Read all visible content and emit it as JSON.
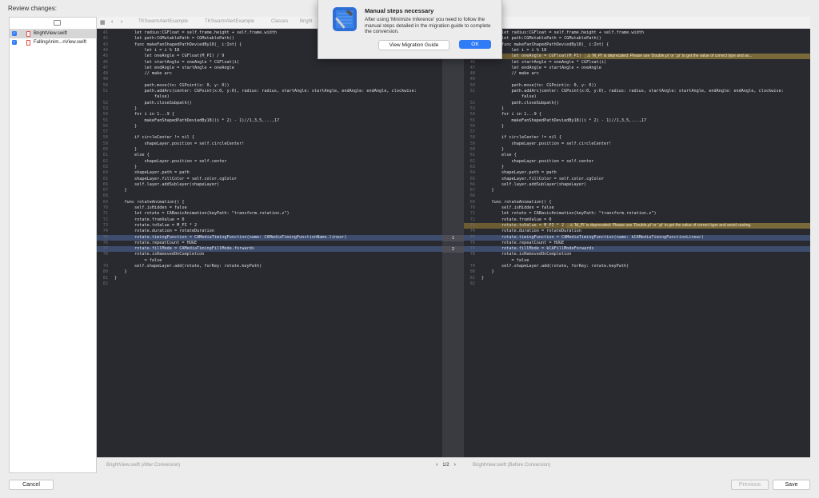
{
  "window": {
    "title": "Review changes:"
  },
  "sidebar": {
    "files": [
      {
        "name": "BrightView.swift",
        "checked": true,
        "selected": true
      },
      {
        "name": "FallingAnim...nView.swift",
        "checked": true,
        "selected": false
      }
    ]
  },
  "toolbar": {
    "crumbs": [
      "TKSwarmAlertExample",
      "TKSwarmAlertExample",
      "Classes",
      "Bright"
    ]
  },
  "left_code": [
    {
      "n": "41",
      "t": "        let radius:CGFloat = self.frame.height + self.frame.width"
    },
    {
      "n": "42",
      "t": "        let path:CGMutablePath = CGMutablePath()"
    },
    {
      "n": "43",
      "t": "        func makeFanShapedPathDeviedBy18(_ i:Int) {"
    },
    {
      "n": "44",
      "t": "            let i = i % 18"
    },
    {
      "n": "45",
      "t": "            let oneAngle = CGFloat(M_PI) / 9"
    },
    {
      "n": "46",
      "t": "            let startAngle = oneAngle * CGFloat(i)"
    },
    {
      "n": "47",
      "t": "            let endAngle = startAngle + oneAngle"
    },
    {
      "n": "48",
      "t": "            // make arc"
    },
    {
      "n": "49",
      "t": ""
    },
    {
      "n": "50",
      "t": "            path.move(to: CGPoint(x: 0, y: 0))"
    },
    {
      "n": "51",
      "t": "            path.addArc(center: CGPoint(x:0, y:0), radius: radius, startAngle: startAngle, endAngle: endAngle, clockwise:"
    },
    {
      "n": "",
      "t": "                false)"
    },
    {
      "n": "52",
      "t": "            path.closeSubpath()"
    },
    {
      "n": "53",
      "t": "        }"
    },
    {
      "n": "54",
      "t": "        for i in 1...9 {"
    },
    {
      "n": "55",
      "t": "            makeFanShapedPathDeviedBy18((i * 2) - 1)//1,3,5,...,17"
    },
    {
      "n": "56",
      "t": "        }"
    },
    {
      "n": "57",
      "t": ""
    },
    {
      "n": "58",
      "t": "        if circleCenter != nil {"
    },
    {
      "n": "59",
      "t": "            shapeLayer.position = self.circleCenter!"
    },
    {
      "n": "60",
      "t": "        }"
    },
    {
      "n": "61",
      "t": "        else {"
    },
    {
      "n": "62",
      "t": "            shapeLayer.position = self.center"
    },
    {
      "n": "63",
      "t": "        }"
    },
    {
      "n": "64",
      "t": "        shapeLayer.path = path"
    },
    {
      "n": "65",
      "t": "        shapeLayer.fillColor = self.color.cgColor"
    },
    {
      "n": "66",
      "t": "        self.layer.addSublayer(shapeLayer)"
    },
    {
      "n": "67",
      "t": "    }"
    },
    {
      "n": "68",
      "t": ""
    },
    {
      "n": "69",
      "t": "    func rotateAnimation() {"
    },
    {
      "n": "70",
      "t": "        self.isHidden = false"
    },
    {
      "n": "71",
      "t": "        let rotate = CABasicAnimation(keyPath: \"transform.rotation.z\")"
    },
    {
      "n": "72",
      "t": "        rotate.fromValue = 0"
    },
    {
      "n": "73",
      "t": "        rotate.toValue = M_PI * 2"
    },
    {
      "n": "74",
      "t": "        rotate.duration = rotateDuration"
    },
    {
      "n": "75",
      "t": "        rotate.timingFunction = CAMediaTimingFunction(name: CAMediaTimingFunctionName.linear)",
      "hl": true
    },
    {
      "n": "76",
      "t": "        rotate.repeatCount = HUGE"
    },
    {
      "n": "77",
      "t": "        rotate.fillMode = CAMediaTimingFillMode.forwards",
      "hl": true
    },
    {
      "n": "78",
      "t": "        rotate.isRemovedOnCompletion"
    },
    {
      "n": "",
      "t": "            = false"
    },
    {
      "n": "79",
      "t": "        self.shapeLayer.add(rotate, forKey: rotate.keyPath)"
    },
    {
      "n": "80",
      "t": "    }"
    },
    {
      "n": "81",
      "t": "}"
    },
    {
      "n": "82",
      "t": ""
    }
  ],
  "right_code": [
    {
      "n": "41",
      "t": "        let radius:CGFloat = self.frame.height + self.frame.width"
    },
    {
      "n": "42",
      "t": "        let path:CGMutablePath = CGMutablePath()"
    },
    {
      "n": "43",
      "t": "        func makeFanShapedPathDeviedBy18(_ i:Int) {"
    },
    {
      "n": "44",
      "t": "            let i = i % 18"
    },
    {
      "n": "45",
      "t": "            let oneAngle = CGFloat(M_PI) / 9",
      "warn": true
    },
    {
      "n": "46",
      "t": "            let startAngle = oneAngle * CGFloat(i)"
    },
    {
      "n": "47",
      "t": "            let endAngle = startAngle + oneAngle"
    },
    {
      "n": "48",
      "t": "            // make arc"
    },
    {
      "n": "49",
      "t": ""
    },
    {
      "n": "50",
      "t": "            path.move(to: CGPoint(x: 0, y: 0))"
    },
    {
      "n": "51",
      "t": "            path.addArc(center: CGPoint(x:0, y:0), radius: radius, startAngle: startAngle, endAngle: endAngle, clockwise:"
    },
    {
      "n": "",
      "t": "                false)"
    },
    {
      "n": "52",
      "t": "            path.closeSubpath()"
    },
    {
      "n": "53",
      "t": "        }"
    },
    {
      "n": "54",
      "t": "        for i in 1...9 {"
    },
    {
      "n": "55",
      "t": "            makeFanShapedPathDeviedBy18((i * 2) - 1)//1,3,5,...,17"
    },
    {
      "n": "56",
      "t": "        }"
    },
    {
      "n": "57",
      "t": ""
    },
    {
      "n": "58",
      "t": "        if circleCenter != nil {"
    },
    {
      "n": "59",
      "t": "            shapeLayer.position = self.circleCenter!"
    },
    {
      "n": "60",
      "t": "        }"
    },
    {
      "n": "61",
      "t": "        else {"
    },
    {
      "n": "62",
      "t": "            shapeLayer.position = self.center"
    },
    {
      "n": "63",
      "t": "        }"
    },
    {
      "n": "64",
      "t": "        shapeLayer.path = path"
    },
    {
      "n": "65",
      "t": "        shapeLayer.fillColor = self.color.cgColor"
    },
    {
      "n": "66",
      "t": "        self.layer.addSublayer(shapeLayer)"
    },
    {
      "n": "67",
      "t": "    }"
    },
    {
      "n": "68",
      "t": ""
    },
    {
      "n": "69",
      "t": "    func rotateAnimation() {"
    },
    {
      "n": "70",
      "t": "        self.isHidden = false"
    },
    {
      "n": "71",
      "t": "        let rotate = CABasicAnimation(keyPath: \"transform.rotation.z\")"
    },
    {
      "n": "72",
      "t": "        rotate.fromValue = 0"
    },
    {
      "n": "73",
      "t": "        rotate.toValue = M_PI * 2",
      "warn": true
    },
    {
      "n": "74",
      "t": "        rotate.duration = rotateDuration"
    },
    {
      "n": "75",
      "t": "        rotate.timingFunction = CAMediaTimingFunction(name: kCAMediaTimingFunctionLinear)",
      "hl": true
    },
    {
      "n": "76",
      "t": "        rotate.repeatCount = HUGE"
    },
    {
      "n": "77",
      "t": "        rotate.fillMode = kCAFillModeForwards",
      "hl": true
    },
    {
      "n": "78",
      "t": "        rotate.isRemovedOnCompletion"
    },
    {
      "n": "",
      "t": "            = false"
    },
    {
      "n": "79",
      "t": "        self.shapeLayer.add(rotate, forKey: rotate.keyPath)"
    },
    {
      "n": "80",
      "t": "    }"
    },
    {
      "n": "81",
      "t": "}"
    },
    {
      "n": "82",
      "t": ""
    }
  ],
  "warnings": {
    "first": "'M_PI' is deprecated: Please use 'Double.pi' or '.pi' to get the value of correct type and av...",
    "second": "'M_PI' is deprecated: Please use 'Double.pi' or '.pi' to get the value of correct type and avoid casting."
  },
  "gutter_marks": [
    "1",
    "2"
  ],
  "status": {
    "left": "BrightView.swift (After Conversion)",
    "right": "BrightView.swift (Before Conversion)",
    "page": "1/2"
  },
  "buttons": {
    "cancel": "Cancel",
    "previous": "Previous",
    "save": "Save"
  },
  "dialog": {
    "title": "Manual steps necessary",
    "text": "After using 'Minimize Inference' you need to follow the manual steps detailed in the migration guide to complete the conversion.",
    "guide_btn": "View Migration Guide",
    "ok_btn": "OK"
  },
  "colors": {
    "editor_bg": "#292a30",
    "accent": "#2f7cf6",
    "highlight": "#3e4d6e",
    "warning": "#6b5c32"
  }
}
